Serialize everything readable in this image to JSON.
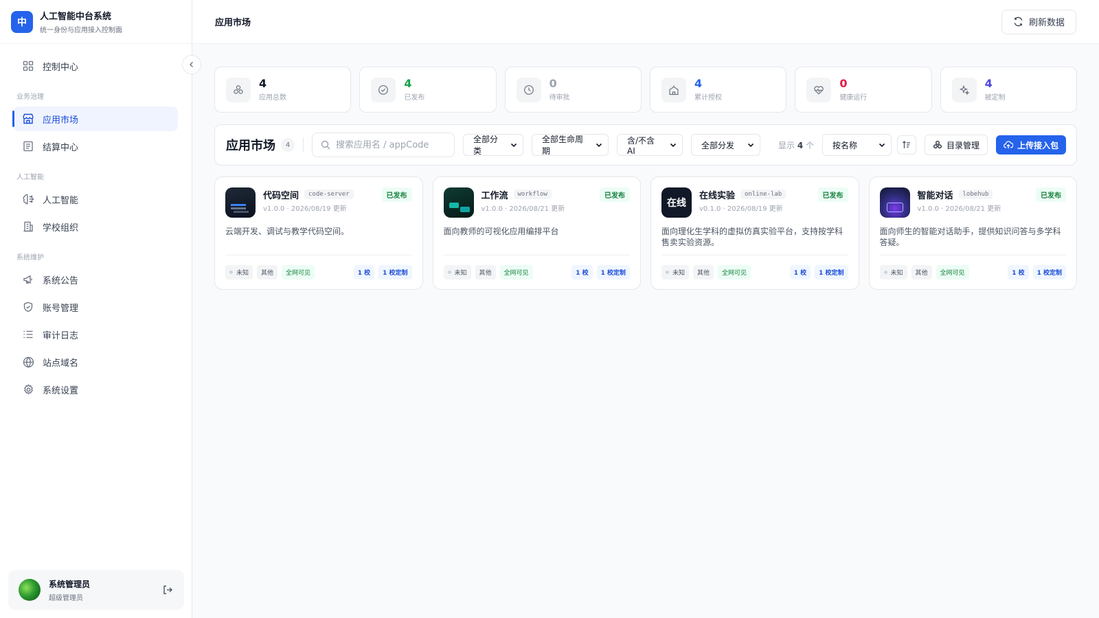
{
  "brand": {
    "logo_text": "中",
    "title": "人工智能中台系统",
    "subtitle": "统一身份与应用接入控制面"
  },
  "sidebar": {
    "top": [
      {
        "label": "控制中心",
        "icon": "grid-icon"
      }
    ],
    "groups": [
      {
        "title": "业务治理",
        "items": [
          {
            "label": "应用市场",
            "icon": "store-icon",
            "active": true
          },
          {
            "label": "结算中心",
            "icon": "receipt-icon"
          }
        ]
      },
      {
        "title": "人工智能",
        "items": [
          {
            "label": "人工智能",
            "icon": "brain-icon"
          },
          {
            "label": "学校组织",
            "icon": "building-icon"
          }
        ]
      },
      {
        "title": "系统维护",
        "items": [
          {
            "label": "系统公告",
            "icon": "megaphone-icon"
          },
          {
            "label": "账号管理",
            "icon": "shield-icon"
          },
          {
            "label": "审计日志",
            "icon": "list-icon"
          },
          {
            "label": "站点域名",
            "icon": "globe-icon"
          },
          {
            "label": "系统设置",
            "icon": "gear-icon"
          }
        ]
      }
    ],
    "user": {
      "name": "系统管理员",
      "role": "超级管理员"
    }
  },
  "header": {
    "title": "应用市场",
    "refresh_label": "刷新数据"
  },
  "stats": [
    {
      "value": "4",
      "label": "应用总数",
      "color": "#111827",
      "icon": "apps-icon"
    },
    {
      "value": "4",
      "label": "已发布",
      "color": "#16a34a",
      "icon": "check-circle-icon"
    },
    {
      "value": "0",
      "label": "待审批",
      "color": "#9ca3af",
      "icon": "clock-icon"
    },
    {
      "value": "4",
      "label": "累计授权",
      "color": "#2563eb",
      "icon": "school-icon"
    },
    {
      "value": "0",
      "label": "健康运行",
      "color": "#e11d48",
      "icon": "heart-pulse-icon"
    },
    {
      "value": "4",
      "label": "被定制",
      "color": "#4f46e5",
      "icon": "sparkles-icon"
    }
  ],
  "toolbar": {
    "title": "应用市场",
    "count": "4",
    "search_placeholder": "搜索应用名 / appCode",
    "filters": [
      "全部分类",
      "全部生命周期",
      "含/不含 AI",
      "全部分发"
    ],
    "shown_prefix": "显示",
    "shown_count": "4",
    "shown_suffix": "个",
    "sort": "按名称",
    "catalog_label": "目录管理",
    "upload_label": "上传接入包"
  },
  "apps": [
    {
      "name": "代码空间",
      "code": "code-server",
      "status": "已发布",
      "version": "v1.0.0 · 2026/08/19 更新",
      "desc": "云端开发、调试与教学代码空间。",
      "icon_style": "code",
      "icon_text": "",
      "tags": {
        "state": "未知",
        "category": "其他",
        "visibility": "全网可见",
        "schools": "1 校",
        "custom": "1 校定制"
      }
    },
    {
      "name": "工作流",
      "code": "workflow",
      "status": "已发布",
      "version": "v1.0.0 · 2026/08/21 更新",
      "desc": "面向教师的可视化应用编排平台",
      "icon_style": "wf",
      "icon_text": "",
      "tags": {
        "state": "未知",
        "category": "其他",
        "visibility": "全网可见",
        "schools": "1 校",
        "custom": "1 校定制"
      }
    },
    {
      "name": "在线实验",
      "code": "online-lab",
      "status": "已发布",
      "version": "v0.1.0 · 2026/08/19 更新",
      "desc": "面向理化生学科的虚拟仿真实验平台，支持按学科售卖实验资源。",
      "icon_style": "lab",
      "icon_text": "在线",
      "tags": {
        "state": "未知",
        "category": "其他",
        "visibility": "全网可见",
        "schools": "1 校",
        "custom": "1 校定制"
      }
    },
    {
      "name": "智能对话",
      "code": "lobehub",
      "status": "已发布",
      "version": "v1.0.0 · 2026/08/21 更新",
      "desc": "面向师生的智能对话助手，提供知识问答与多学科答疑。",
      "icon_style": "chat",
      "icon_text": "",
      "tags": {
        "state": "未知",
        "category": "其他",
        "visibility": "全网可见",
        "schools": "1 校",
        "custom": "1 校定制"
      }
    }
  ]
}
